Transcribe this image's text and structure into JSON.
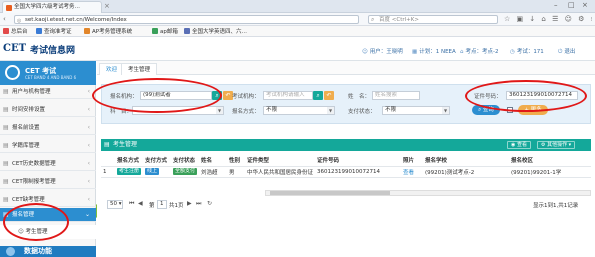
{
  "browser": {
    "tab_title": "全国大学四六级考试考务…",
    "url": "set.kaoji.etest.net.cn/Welcome/Index",
    "search_placeholder": "百度 <Ctrl+K>",
    "bookmarks": [
      {
        "label": "总后台",
        "color": "#e24a4a"
      },
      {
        "label": "查询准考证",
        "color": "#3a7bd5"
      },
      {
        "label": "AP考务管理系统",
        "color": "#e2862a"
      },
      {
        "label": "ap邮箱",
        "color": "#3aa05a"
      },
      {
        "label": "全国大学英语四、六…",
        "color": "#5a6fb5"
      }
    ]
  },
  "header": {
    "logo_latin": "CET",
    "logo_cn": "考试信息网",
    "user_label": "用户：王晓明",
    "items": [
      "计划：1 NEEA",
      "考点：考点-2",
      "考试：171",
      "退出"
    ]
  },
  "sidebar": {
    "head_title": "CET 考试",
    "head_sub": "CET BAND 4 AND BAND 6",
    "items": [
      "用户与机构管理",
      "时间安排设置",
      "报名前设置",
      "学籍库管理",
      "CET历史数据管理",
      "CET限制报考管理",
      "CET缺考管理",
      "报名管理"
    ],
    "sub_item": "考生管理",
    "footer": "数据功能"
  },
  "page_tabs": {
    "home": "欢迎",
    "current": "考生管理"
  },
  "filter": {
    "org_label": "报名机构：",
    "org_value": "(99)测试者",
    "exam_org_label": "考试机构：",
    "exam_org_placeholder": "考试机构请输入",
    "name_label": "姓　名：",
    "name_placeholder": "姓名搜索",
    "id_label": "证件号码：",
    "id_value": "360123199010072714",
    "subject_label": "科　目：",
    "method_label": "报名方式：",
    "method_value": "不限",
    "pay_label": "支付状态：",
    "pay_value": "不限",
    "query_btn": "查询",
    "extra_btn": "更多"
  },
  "panel": {
    "title": "考生管理",
    "btn_view": "查看",
    "btn_more": "其他操作"
  },
  "table": {
    "headers": [
      "",
      "报名方式",
      "支付方式",
      "支付状态",
      "姓名",
      "性别",
      "证件类型",
      "证件号码",
      "照片",
      "报名学校",
      "报名校区"
    ],
    "rows": [
      [
        "1",
        "考生注册",
        "线上",
        "全额支付",
        "刘浩超",
        "男",
        "中华人民共和国居民身份证",
        "360123199010072714",
        "查看",
        "(99201)测试考点-2",
        "(99201)99201-1学"
      ]
    ]
  },
  "pager": {
    "page_size": "50",
    "first": "第",
    "page_no": "1",
    "total_pages": "共1页",
    "summary": "显示1到1,共1记录"
  }
}
